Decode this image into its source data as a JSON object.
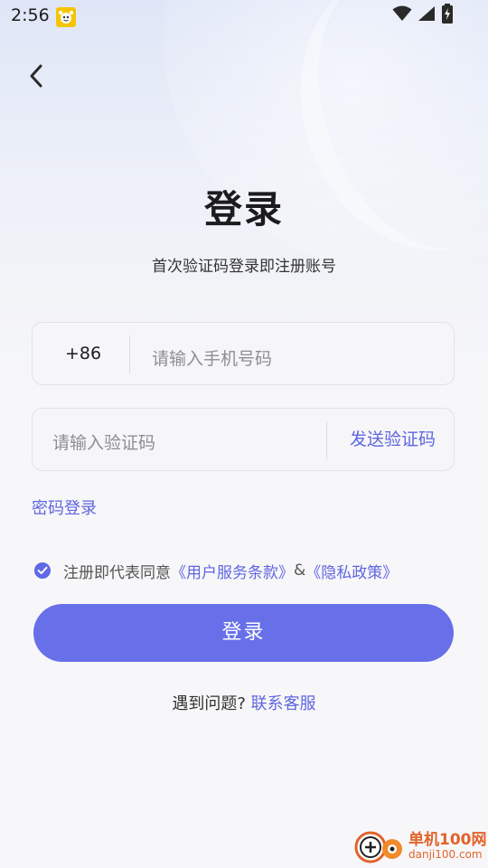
{
  "status_bar": {
    "time": "2:56"
  },
  "header": {
    "title": "登录",
    "subtitle": "首次验证码登录即注册账号"
  },
  "phone_field": {
    "country_code": "+86",
    "placeholder": "请输入手机号码",
    "value": ""
  },
  "code_field": {
    "placeholder": "请输入验证码",
    "value": "",
    "send_label": "发送验证码"
  },
  "password_login_label": "密码登录",
  "agreement": {
    "prefix": "注册即代表同意",
    "terms_link": "《用户服务条款》",
    "connector": "&",
    "privacy_link": "《隐私政策》",
    "checked": true
  },
  "login_button_label": "登录",
  "help": {
    "question": "遇到问题?",
    "contact_link": "联系客服"
  },
  "watermark": {
    "cn": "单机100网",
    "en": "danji100.com"
  },
  "colors": {
    "accent": "#6770e8",
    "link": "#5f66e0",
    "background": "#f7f7f9"
  }
}
